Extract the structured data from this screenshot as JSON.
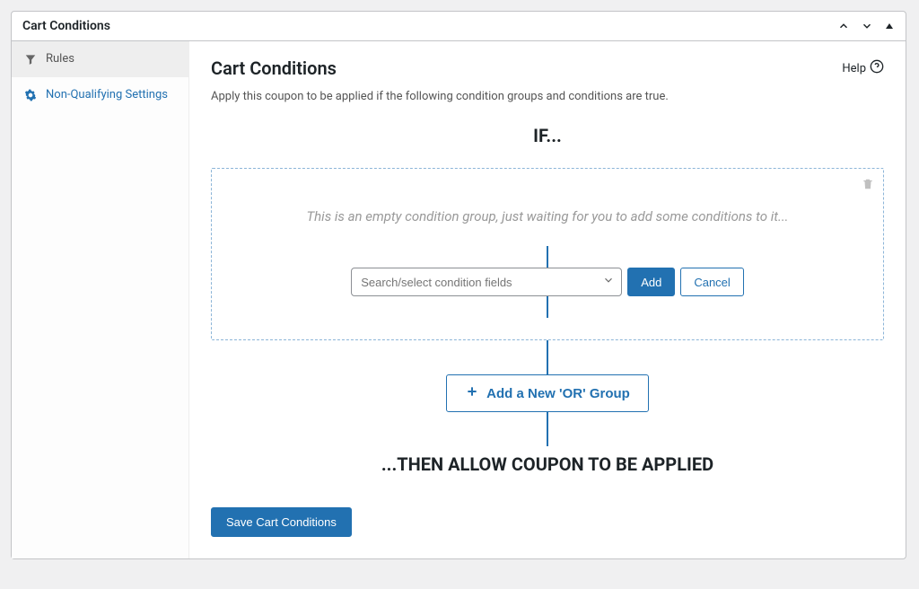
{
  "panel": {
    "title": "Cart Conditions"
  },
  "sidebar": {
    "items": [
      {
        "label": "Rules"
      },
      {
        "label": "Non-Qualifying Settings"
      }
    ]
  },
  "main": {
    "title": "Cart Conditions",
    "help_label": "Help",
    "description": "Apply this coupon to be applied if the following condition groups and conditions are true.",
    "if_heading": "IF...",
    "empty_group_text": "This is an empty condition group, just waiting for you to add some conditions to it...",
    "select_placeholder": "Search/select condition fields",
    "add_button": "Add",
    "cancel_button": "Cancel",
    "add_or_group": "Add a New 'OR' Group",
    "then_heading": "...THEN ALLOW COUPON TO BE APPLIED",
    "save_button": "Save Cart Conditions"
  }
}
